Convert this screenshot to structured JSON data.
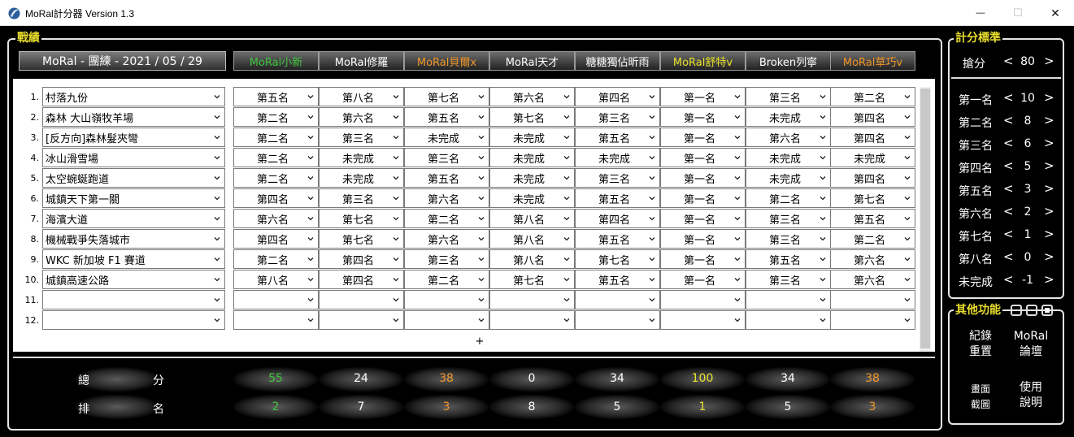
{
  "window": {
    "title": "MoRal計分器 Version 1.3",
    "minimize": "—",
    "maximize": "☐",
    "close": "✕"
  },
  "record": {
    "legend": "戰績",
    "session_title": "MoRal - 團練 - 2021 / 05 / 29",
    "players": [
      {
        "name": "MoRal小新",
        "color": "#3ec43e"
      },
      {
        "name": "MoRal修羅",
        "color": "#ffffff"
      },
      {
        "name": "MoRal貝爾x",
        "color": "#f0962a"
      },
      {
        "name": "MoRal天才",
        "color": "#ffffff"
      },
      {
        "name": "糖糖獨佔昕雨",
        "color": "#ffffff"
      },
      {
        "name": "MoRal舒特v",
        "color": "#e8e32b"
      },
      {
        "name": "Broken列寧",
        "color": "#ffffff"
      },
      {
        "name": "MoRal草巧v",
        "color": "#f0962a"
      }
    ],
    "rows": [
      {
        "num": "1.",
        "track": "村落九份",
        "ranks": [
          "第五名",
          "第八名",
          "第七名",
          "第六名",
          "第四名",
          "第一名",
          "第三名",
          "第二名"
        ]
      },
      {
        "num": "2.",
        "track": "森林 大山嶺牧羊場",
        "ranks": [
          "第二名",
          "第六名",
          "第五名",
          "第七名",
          "第三名",
          "第一名",
          "未完成",
          "第四名"
        ]
      },
      {
        "num": "3.",
        "track": "[反方向]森林髮夾彎",
        "ranks": [
          "第二名",
          "第三名",
          "未完成",
          "未完成",
          "第五名",
          "第一名",
          "第六名",
          "第四名"
        ]
      },
      {
        "num": "4.",
        "track": "冰山滑雪場",
        "ranks": [
          "第二名",
          "未完成",
          "第三名",
          "未完成",
          "未完成",
          "第一名",
          "未完成",
          "未完成"
        ]
      },
      {
        "num": "5.",
        "track": "太空蜿蜒跑道",
        "ranks": [
          "第二名",
          "未完成",
          "第五名",
          "未完成",
          "第三名",
          "第一名",
          "未完成",
          "第四名"
        ]
      },
      {
        "num": "6.",
        "track": "城鎮天下第一關",
        "ranks": [
          "第四名",
          "第三名",
          "第六名",
          "未完成",
          "第五名",
          "第一名",
          "第二名",
          "第七名"
        ]
      },
      {
        "num": "7.",
        "track": "海濱大道",
        "ranks": [
          "第六名",
          "第七名",
          "第二名",
          "第八名",
          "第四名",
          "第一名",
          "第三名",
          "第五名"
        ]
      },
      {
        "num": "8.",
        "track": "機械戰爭失落城市",
        "ranks": [
          "第四名",
          "第七名",
          "第六名",
          "第八名",
          "第五名",
          "第一名",
          "第三名",
          "第二名"
        ]
      },
      {
        "num": "9.",
        "track": "WKC 新加坡 F1 賽道",
        "ranks": [
          "第二名",
          "第四名",
          "第三名",
          "第八名",
          "第七名",
          "第一名",
          "第五名",
          "第六名"
        ]
      },
      {
        "num": "10.",
        "track": "城鎮高速公路",
        "ranks": [
          "第八名",
          "第四名",
          "第二名",
          "第七名",
          "第五名",
          "第一名",
          "第三名",
          "第六名"
        ]
      },
      {
        "num": "11.",
        "track": "",
        "ranks": [
          "",
          "",
          "",
          "",
          "",
          "",
          "",
          ""
        ]
      },
      {
        "num": "12.",
        "track": "",
        "ranks": [
          "",
          "",
          "",
          "",
          "",
          "",
          "",
          ""
        ]
      }
    ],
    "add_label": "+"
  },
  "summary": {
    "total_label_a": "總",
    "total_label_b": "分",
    "rank_label_a": "排",
    "rank_label_b": "名",
    "totals": [
      "55",
      "24",
      "38",
      "0",
      "34",
      "100",
      "34",
      "38"
    ],
    "places": [
      "2",
      "7",
      "3",
      "8",
      "5",
      "1",
      "5",
      "3"
    ],
    "colors": [
      "#3ec43e",
      "#ffffff",
      "#f0962a",
      "#ffffff",
      "#ffffff",
      "#e8e32b",
      "#ffffff",
      "#f0962a"
    ]
  },
  "scoring": {
    "legend": "計分標準",
    "steal": {
      "label": "搶分",
      "value": "80"
    },
    "left_arrow": "<",
    "right_arrow": ">",
    "items": [
      {
        "label": "第一名",
        "value": "10"
      },
      {
        "label": "第二名",
        "value": "8"
      },
      {
        "label": "第三名",
        "value": "6"
      },
      {
        "label": "第四名",
        "value": "5"
      },
      {
        "label": "第五名",
        "value": "3"
      },
      {
        "label": "第六名",
        "value": "2"
      },
      {
        "label": "第七名",
        "value": "1"
      },
      {
        "label": "第八名",
        "value": "0"
      },
      {
        "label": "未完成",
        "value": "-1"
      }
    ]
  },
  "other": {
    "legend": "其他功能",
    "reset_line1": "紀錄",
    "reset_line2": "重置",
    "forum_line1": "MoRal",
    "forum_line2": "論壇",
    "screenshot_line1": "畫面",
    "screenshot_line2": "截圖",
    "help_line1": "使用",
    "help_line2": "說明"
  }
}
